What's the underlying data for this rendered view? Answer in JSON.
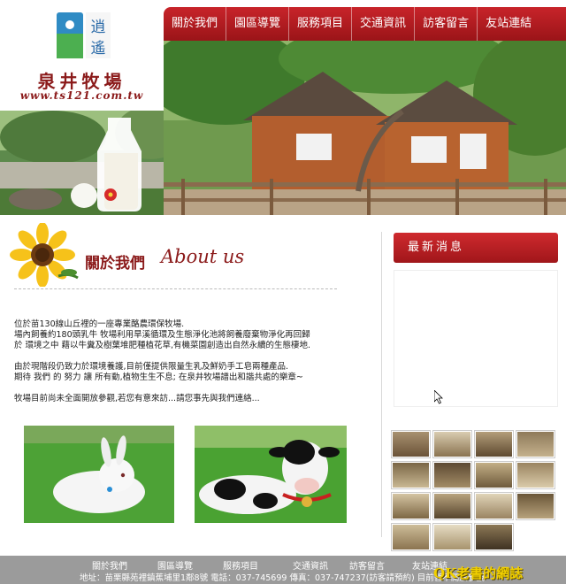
{
  "logo": {
    "brand_name": "泉井牧場",
    "url": "www.ts121.com.tw",
    "mark_text": "逍遙"
  },
  "nav": {
    "items": [
      "關於我們",
      "園區導覽",
      "服務項目",
      "交通資訊",
      "訪客留言",
      "友站連結"
    ]
  },
  "about": {
    "title_zh": "關於我們",
    "title_en": "About us",
    "paragraphs": [
      "位於苗130線山丘裡的一座專業酪農環保牧場.\n場內飼養約180頭乳牛 牧場利用旱溪循環及生態淨化池將飼養廢棄物淨化再回歸\n於 環境之中 藉以牛糞及樹葉堆肥種植花草,有機菜園創造出自然永續的生態棲地.",
      "由於現階段仍致力於環境養護,目前僅提供限量生乳及鮮奶手工皂兩種產品.\n期待 我們 的 努力 讓 所有動,植物生生不息; 在泉井牧場譜出和諧共處的樂章~",
      "牧場目前尚未全面開放參觀,若您有意來訪...請您事先與我們連絡..."
    ]
  },
  "news": {
    "title": "最新消息"
  },
  "footer": {
    "nav_items": [
      "關於我們",
      "園區導覽",
      "服務項目",
      "交通資訊",
      "訪客留言",
      "友站連結"
    ],
    "address": "地址：苗栗縣苑裡鎮蕉埔里1鄰8號 電話：037-745699 傳真：037-747237(訪客請預約) 目前暫不開放參觀"
  },
  "watermark": "QK老書的網誌",
  "colors": {
    "brand_red": "#b01c20",
    "title_red": "#8b1a1a",
    "footer_gray": "#9b9b9b",
    "watermark_yellow": "#f2d000"
  },
  "icons": {
    "cursor": "mouse-pointer-icon"
  }
}
